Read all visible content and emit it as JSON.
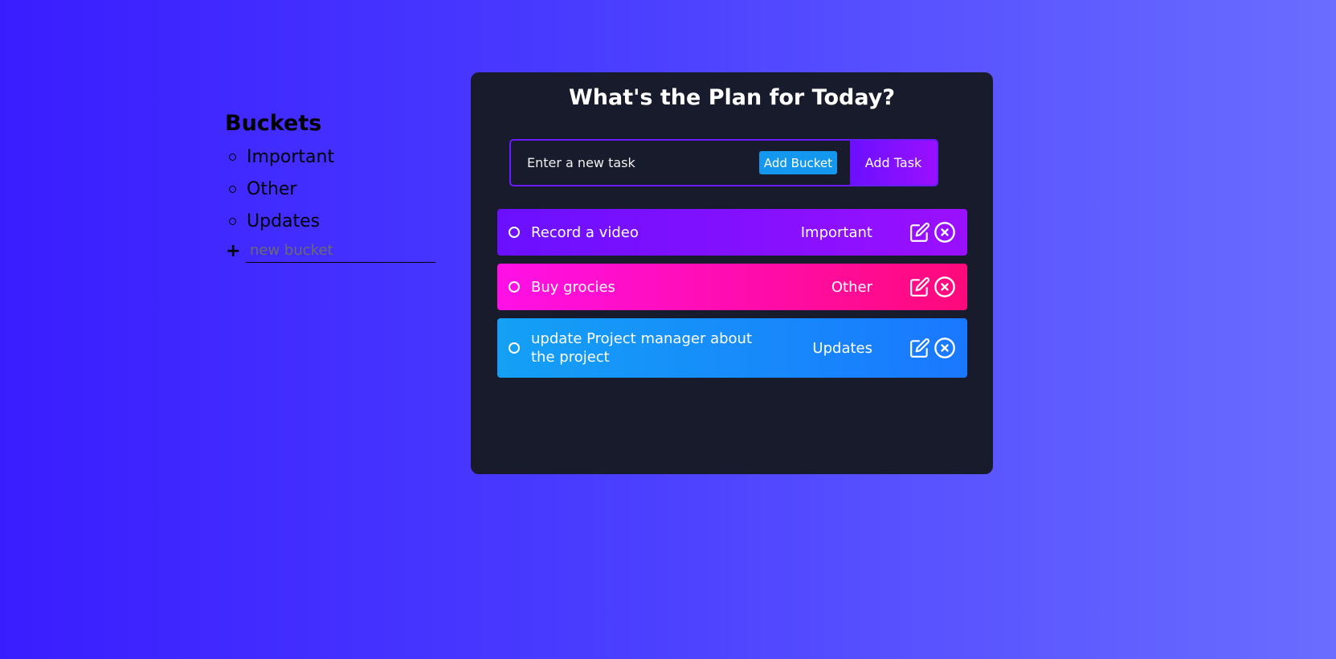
{
  "sidebar": {
    "title": "Buckets",
    "buckets": [
      {
        "label": "Important"
      },
      {
        "label": "Other"
      },
      {
        "label": "Updates"
      }
    ],
    "new_bucket_placeholder": "new bucket",
    "plus_symbol": "+"
  },
  "panel": {
    "title": "What's the Plan for Today?",
    "task_input_placeholder": "Enter a new task",
    "add_bucket_label": "Add Bucket",
    "add_task_label": "Add Task"
  },
  "tasks": [
    {
      "text": "Record a video",
      "bucket": "Important",
      "color": "purple"
    },
    {
      "text": "Buy grocies",
      "bucket": "Other",
      "color": "pink"
    },
    {
      "text": "update Project manager about the project",
      "bucket": "Updates",
      "color": "blue"
    }
  ],
  "colors": {
    "background_start": "#3a1dff",
    "background_end": "#6a6dff",
    "panel": "#181b2b",
    "purple": "#7a10ff",
    "pink": "#ff10c0",
    "blue": "#1497ee"
  },
  "icons": {
    "edit": "edit-icon",
    "delete": "close-circle-icon",
    "complete": "circle-icon"
  }
}
